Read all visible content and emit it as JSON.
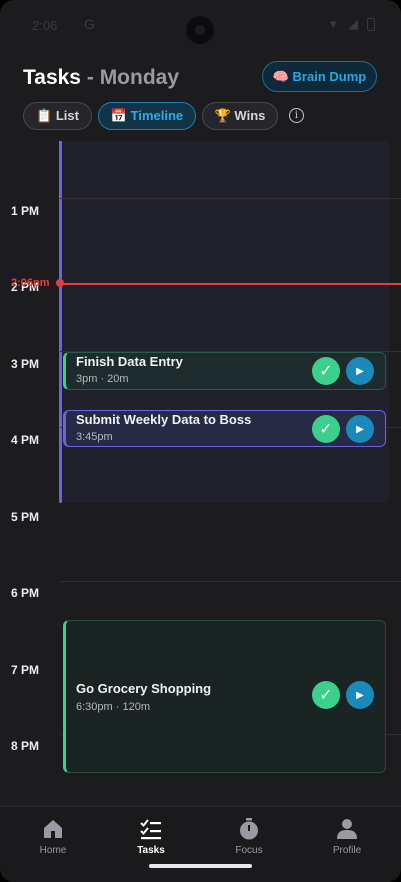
{
  "status_bar": {
    "time": "2:06",
    "sync_glyph": "G"
  },
  "header": {
    "title": "Tasks",
    "separator": "-",
    "day": "Monday",
    "brain_dump_label": "🧠 Brain Dump"
  },
  "tabs": [
    {
      "label": "📋 List"
    },
    {
      "label": "📅 Timeline"
    },
    {
      "label": "🏆 Wins"
    }
  ],
  "info_glyph": "i",
  "timeline": {
    "hours": [
      "1 PM",
      "2 PM",
      "3 PM",
      "4 PM",
      "5 PM",
      "6 PM",
      "7 PM",
      "8 PM"
    ],
    "now_label": "2:06pm",
    "tasks": [
      {
        "title": "Finish Data Entry",
        "meta": "3pm · 20m"
      },
      {
        "title": "Submit Weekly Data to Boss",
        "meta": "3:45pm"
      },
      {
        "title": "Go Grocery Shopping",
        "meta": "6:30pm · 120m"
      }
    ],
    "check_glyph": "✓",
    "play_glyph": "▶"
  },
  "bottom_nav": [
    {
      "label": "Home",
      "icon": "home-icon"
    },
    {
      "label": "Tasks",
      "icon": "tasks-icon"
    },
    {
      "label": "Focus",
      "icon": "stopwatch-icon"
    },
    {
      "label": "Profile",
      "icon": "person-icon"
    }
  ],
  "colors": {
    "accent_blue": "#2aa6e0",
    "purple_bar": "#6c63e0",
    "green": "#3bd08e",
    "now_red": "#e0413d"
  }
}
